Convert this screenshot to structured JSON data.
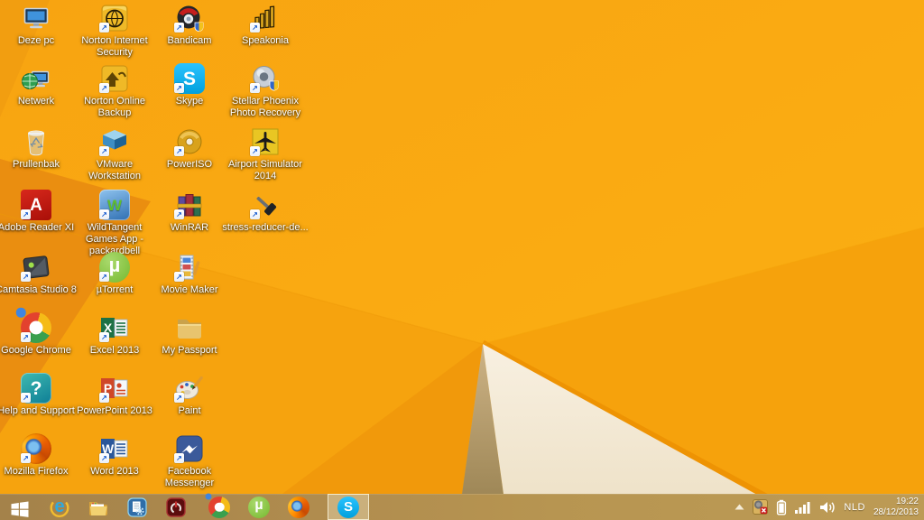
{
  "desktop": {
    "icons": [
      {
        "label": "Deze pc",
        "icon": "this-pc",
        "shortcut": false
      },
      {
        "label": "Norton Internet Security",
        "icon": "norton-internet-security",
        "shortcut": true
      },
      {
        "label": "Bandicam",
        "icon": "bandicam",
        "shortcut": true
      },
      {
        "label": "Speakonia",
        "icon": "speakonia",
        "shortcut": true
      },
      {
        "label": "Netwerk",
        "icon": "network",
        "shortcut": false
      },
      {
        "label": "Norton Online Backup",
        "icon": "norton-online-backup",
        "shortcut": true
      },
      {
        "label": "Skype",
        "icon": "skype",
        "shortcut": true
      },
      {
        "label": "Stellar Phoenix Photo Recovery",
        "icon": "stellar-phoenix-photo-recovery",
        "shortcut": true
      },
      {
        "label": "Prullenbak",
        "icon": "recycle-bin",
        "shortcut": false
      },
      {
        "label": "VMware Workstation",
        "icon": "vmware-workstation",
        "shortcut": true
      },
      {
        "label": "PowerISO",
        "icon": "poweriso",
        "shortcut": true
      },
      {
        "label": "Airport Simulator 2014",
        "icon": "airport-simulator-2014",
        "shortcut": true
      },
      {
        "label": "Adobe Reader XI",
        "icon": "adobe-reader",
        "shortcut": true
      },
      {
        "label": "WildTangent Games App - packardbell",
        "icon": "wildtangent-games",
        "shortcut": true
      },
      {
        "label": "WinRAR",
        "icon": "winrar",
        "shortcut": true
      },
      {
        "label": "stress-reducer-de...",
        "icon": "stress-reducer",
        "shortcut": true
      },
      {
        "label": "Camtasia Studio 8",
        "icon": "camtasia-studio",
        "shortcut": true
      },
      {
        "label": "µTorrent",
        "icon": "utorrent",
        "shortcut": true
      },
      {
        "label": "Movie Maker",
        "icon": "movie-maker",
        "shortcut": true
      },
      {
        "label": "Google Chrome",
        "icon": "google-chrome",
        "shortcut": true
      },
      {
        "label": "Excel 2013",
        "icon": "excel-2013",
        "shortcut": true
      },
      {
        "label": "My Passport",
        "icon": "folder",
        "shortcut": false
      },
      {
        "label": "Help and Support",
        "icon": "help-and-support",
        "shortcut": true
      },
      {
        "label": "PowerPoint 2013",
        "icon": "powerpoint-2013",
        "shortcut": true
      },
      {
        "label": "Paint",
        "icon": "paint",
        "shortcut": true
      },
      {
        "label": "Mozilla Firefox",
        "icon": "mozilla-firefox",
        "shortcut": true
      },
      {
        "label": "Word 2013",
        "icon": "word-2013",
        "shortcut": true
      },
      {
        "label": "Facebook Messenger",
        "icon": "facebook-messenger",
        "shortcut": true
      }
    ]
  },
  "taskbar": {
    "buttons": [
      {
        "name": "start"
      },
      {
        "name": "internet-explorer"
      },
      {
        "name": "file-explorer"
      },
      {
        "name": "system-utility"
      },
      {
        "name": "power"
      },
      {
        "name": "google-chrome"
      },
      {
        "name": "utorrent"
      },
      {
        "name": "firefox"
      },
      {
        "name": "skype",
        "active": true
      }
    ],
    "tray": {
      "language": "NLD",
      "time": "19:22",
      "date": "28/12/2013"
    }
  },
  "colors": {
    "wallpaper_main": "#FAAB12",
    "wallpaper_dark_fold": "#EA8E10",
    "wallpaper_cream_fold": "#F3E8D3",
    "wallpaper_tan_shadow": "#B2945F",
    "wallpaper_edge_stripe": "#EE9303",
    "taskbar": "#B08C4E",
    "active_button_highlight": "#FDF4D5",
    "label_text": "#FFFFFF"
  }
}
